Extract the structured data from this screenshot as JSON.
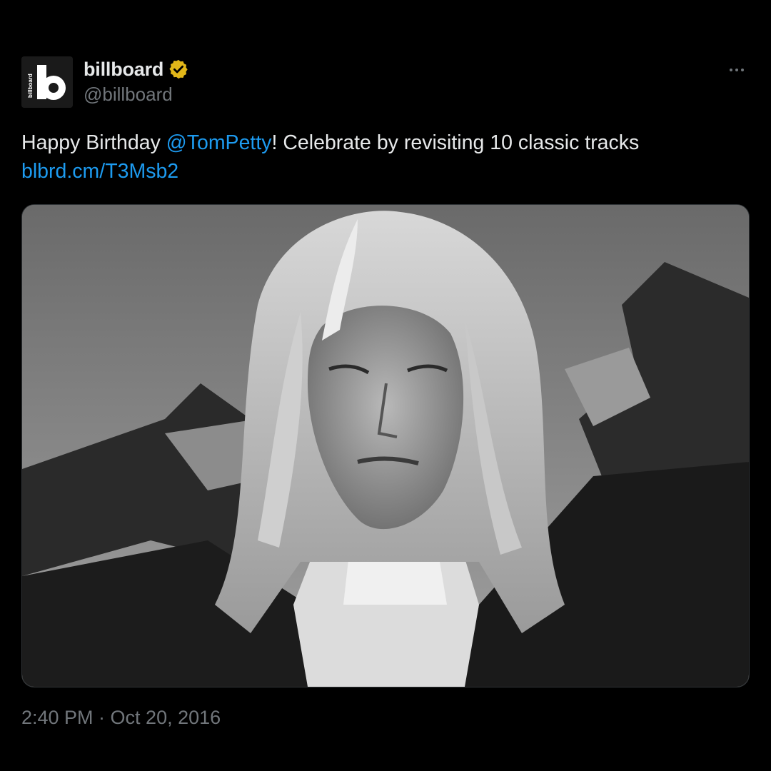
{
  "author": {
    "display_name": "billboard",
    "handle": "@billboard",
    "avatar_icon": "billboard-logo-icon",
    "avatar_text": "billboard",
    "verified": true,
    "verified_icon": "verified-badge-icon",
    "verified_color": "#e2b719"
  },
  "more_icon": "ellipsis-icon",
  "tweet": {
    "text_before": "Happy Birthday ",
    "mention": "@TomPetty",
    "text_after": "! Celebrate by revisiting 10 classic tracks",
    "link": "blbrd.cm/T3Msb2",
    "timestamp": "2:40 PM · Oct 20, 2016"
  },
  "media": {
    "icon": "photo-image",
    "style": "black-and-white portrait"
  },
  "colors": {
    "background": "#000000",
    "text": "#e7e9ea",
    "secondary": "#71767b",
    "accent": "#1d9bf0"
  }
}
